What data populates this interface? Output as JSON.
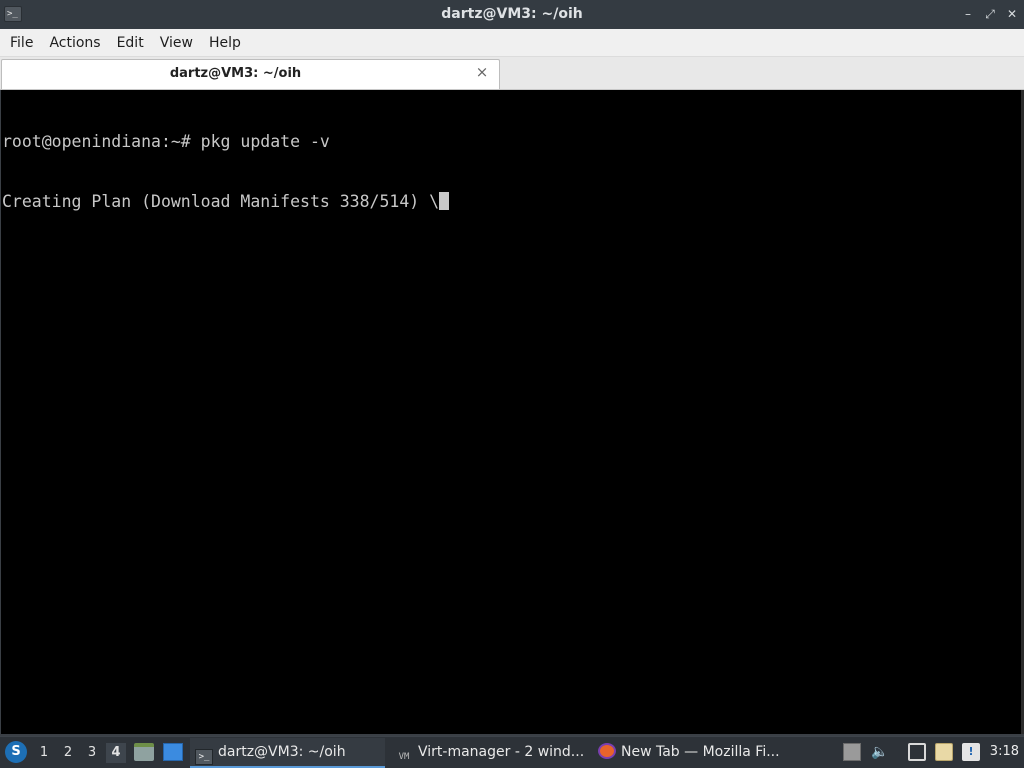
{
  "window": {
    "title": "dartz@VM3: ~/oih",
    "minimize_glyph": "–",
    "maximize_glyph": "⤢",
    "close_glyph": "✕"
  },
  "menubar": {
    "items": [
      "File",
      "Actions",
      "Edit",
      "View",
      "Help"
    ]
  },
  "tabs": [
    {
      "label": "dartz@VM3: ~/oih",
      "close_glyph": "×"
    }
  ],
  "terminal": {
    "lines": [
      "root@openindiana:~# pkg update -v",
      "Creating Plan (Download Manifests 338/514) \\"
    ],
    "background": "#000000",
    "foreground": "#c8c8c8"
  },
  "taskbar": {
    "workspaces": [
      "1",
      "2",
      "3",
      "4"
    ],
    "active_workspace": "4",
    "tasks": [
      {
        "label": "dartz@VM3: ~/oih",
        "icon": "terminal-icon"
      },
      {
        "label": "Virt-manager - 2 wind...",
        "icon": "virt-manager-icon"
      },
      {
        "label": "New Tab — Mozilla Fi...",
        "icon": "firefox-icon"
      }
    ],
    "clock": "3:18"
  }
}
